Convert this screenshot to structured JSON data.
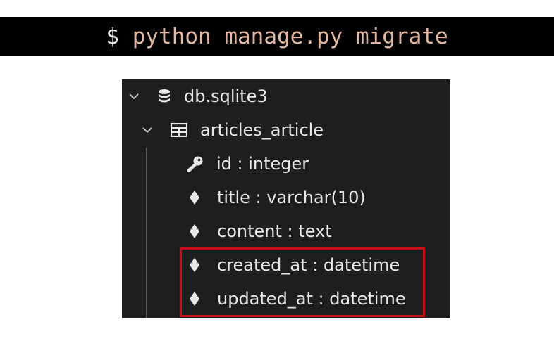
{
  "terminal": {
    "prompt": "$",
    "command": "python manage.py migrate"
  },
  "explorer": {
    "database": {
      "name": "db.sqlite3",
      "icon": "database-icon",
      "expanded": true
    },
    "table": {
      "name": "articles_article",
      "icon": "table-icon",
      "expanded": true
    },
    "columns": [
      {
        "label": "id : integer",
        "icon": "key-icon"
      },
      {
        "label": "title : varchar(10)",
        "icon": "diamond-icon"
      },
      {
        "label": "content : text",
        "icon": "diamond-icon"
      },
      {
        "label": "created_at : datetime",
        "icon": "diamond-icon"
      },
      {
        "label": "updated_at : datetime",
        "icon": "diamond-icon"
      }
    ],
    "highlight_color": "#c8101a"
  }
}
